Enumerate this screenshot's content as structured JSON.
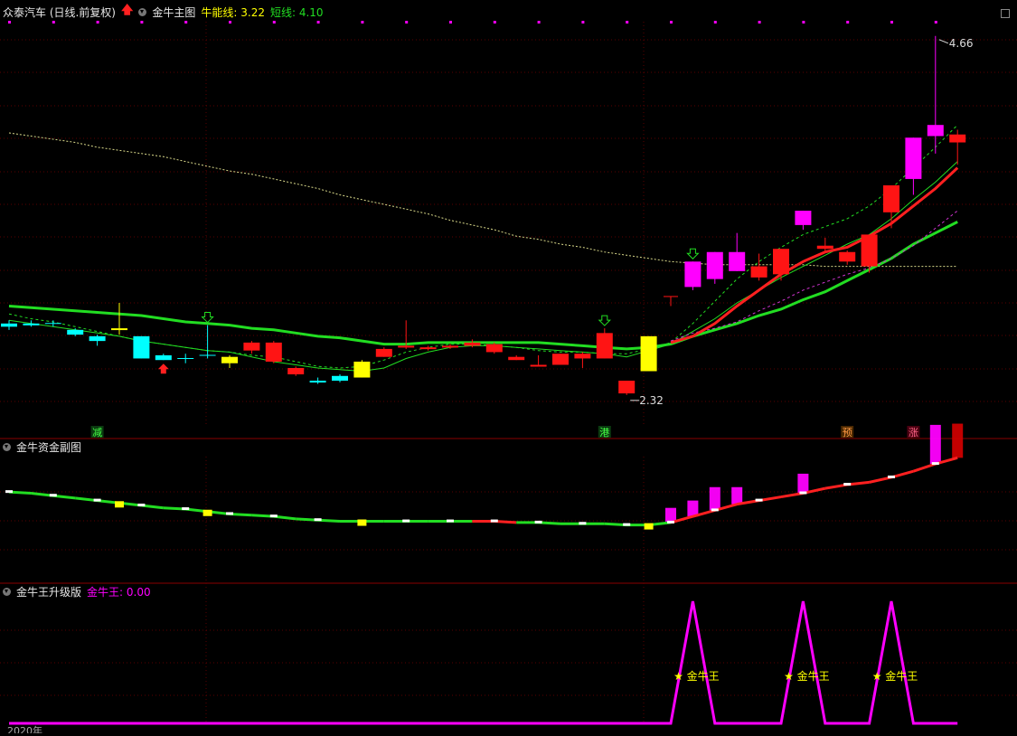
{
  "header": {
    "stock_title": "众泰汽车 (日线.前复权)",
    "main_indicator": "金牛主图",
    "bull_line_label": "牛能线: 3.22",
    "short_line_label": "短线: 4.10"
  },
  "sub_panel_1": {
    "title": "金牛资金副图"
  },
  "sub_panel_2": {
    "title": "金牛王升级版",
    "value_label": "金牛王: 0.00"
  },
  "markers": {
    "high_label": "4.66",
    "low_label": "2.32",
    "signal_jian": "减",
    "signal_gang": "港",
    "signal_yu": "预",
    "signal_zhang": "涨",
    "king_label": "★ 金牛王",
    "bottom_left_label": "2020年"
  },
  "colors": {
    "up": "#ff1414",
    "down": "#00ffff",
    "strong": "#ff00ff",
    "yellow": "#ffff00",
    "green_line": "#22dd22",
    "grid": "#5a0000",
    "panel_border": "#8a0000"
  },
  "chart_data": {
    "type": "candlestick",
    "price_range": [
      2.2,
      4.75
    ],
    "candles": [
      {
        "o": 2.85,
        "h": 2.87,
        "l": 2.81,
        "c": 2.83,
        "t": "down"
      },
      {
        "o": 2.85,
        "h": 2.87,
        "l": 2.83,
        "c": 2.84,
        "t": "down"
      },
      {
        "o": 2.85,
        "h": 2.87,
        "l": 2.83,
        "c": 2.85,
        "t": "cross"
      },
      {
        "o": 2.81,
        "h": 2.82,
        "l": 2.77,
        "c": 2.78,
        "t": "down"
      },
      {
        "o": 2.77,
        "h": 2.78,
        "l": 2.71,
        "c": 2.74,
        "t": "down"
      },
      {
        "o": 2.81,
        "h": 2.98,
        "l": 2.78,
        "c": 2.82,
        "t": "yellow"
      },
      {
        "o": 2.77,
        "h": 2.77,
        "l": 2.63,
        "c": 2.63,
        "t": "down"
      },
      {
        "o": 2.65,
        "h": 2.66,
        "l": 2.62,
        "c": 2.62,
        "t": "down"
      },
      {
        "o": 2.63,
        "h": 2.66,
        "l": 2.6,
        "c": 2.63,
        "t": "cross"
      },
      {
        "o": 2.65,
        "h": 2.84,
        "l": 2.63,
        "c": 2.65,
        "t": "cross"
      },
      {
        "o": 2.6,
        "h": 2.65,
        "l": 2.57,
        "c": 2.64,
        "t": "yellow"
      },
      {
        "o": 2.68,
        "h": 2.74,
        "l": 2.66,
        "c": 2.73,
        "t": "up"
      },
      {
        "o": 2.73,
        "h": 2.74,
        "l": 2.6,
        "c": 2.61,
        "t": "up"
      },
      {
        "o": 2.53,
        "h": 2.58,
        "l": 2.52,
        "c": 2.57,
        "t": "up"
      },
      {
        "o": 2.49,
        "h": 2.51,
        "l": 2.47,
        "c": 2.48,
        "t": "down"
      },
      {
        "o": 2.52,
        "h": 2.53,
        "l": 2.48,
        "c": 2.49,
        "t": "down"
      },
      {
        "o": 2.51,
        "h": 2.62,
        "l": 2.51,
        "c": 2.61,
        "t": "yellow"
      },
      {
        "o": 2.64,
        "h": 2.7,
        "l": 2.64,
        "c": 2.69,
        "t": "up"
      },
      {
        "o": 2.7,
        "h": 2.87,
        "l": 2.69,
        "c": 2.71,
        "t": "up"
      },
      {
        "o": 2.69,
        "h": 2.71,
        "l": 2.68,
        "c": 2.7,
        "t": "up"
      },
      {
        "o": 2.7,
        "h": 2.72,
        "l": 2.69,
        "c": 2.71,
        "t": "up"
      },
      {
        "o": 2.71,
        "h": 2.75,
        "l": 2.7,
        "c": 2.73,
        "t": "up"
      },
      {
        "o": 2.67,
        "h": 2.73,
        "l": 2.66,
        "c": 2.72,
        "t": "up"
      },
      {
        "o": 2.62,
        "h": 2.65,
        "l": 2.62,
        "c": 2.64,
        "t": "up"
      },
      {
        "o": 2.58,
        "h": 2.65,
        "l": 2.58,
        "c": 2.59,
        "t": "up"
      },
      {
        "o": 2.59,
        "h": 2.66,
        "l": 2.59,
        "c": 2.66,
        "t": "up"
      },
      {
        "o": 2.63,
        "h": 2.67,
        "l": 2.57,
        "c": 2.66,
        "t": "up"
      },
      {
        "o": 2.63,
        "h": 2.82,
        "l": 2.63,
        "c": 2.79,
        "t": "up"
      },
      {
        "o": 2.41,
        "h": 2.49,
        "l": 2.4,
        "c": 2.49,
        "t": "up"
      },
      {
        "o": 2.55,
        "h": 2.77,
        "l": 2.55,
        "c": 2.77,
        "t": "yellow"
      },
      {
        "o": 3.02,
        "h": 3.02,
        "l": 2.96,
        "c": 3.02,
        "t": "up_t"
      },
      {
        "o": 3.08,
        "h": 3.24,
        "l": 3.06,
        "c": 3.24,
        "t": "strong"
      },
      {
        "o": 3.13,
        "h": 3.3,
        "l": 3.1,
        "c": 3.3,
        "t": "strong"
      },
      {
        "o": 3.18,
        "h": 3.42,
        "l": 3.18,
        "c": 3.3,
        "t": "strong"
      },
      {
        "o": 3.21,
        "h": 3.29,
        "l": 3.12,
        "c": 3.14,
        "t": "up"
      },
      {
        "o": 3.16,
        "h": 3.32,
        "l": 3.12,
        "c": 3.32,
        "t": "up"
      },
      {
        "o": 3.47,
        "h": 3.56,
        "l": 3.44,
        "c": 3.56,
        "t": "strong"
      },
      {
        "o": 3.32,
        "h": 3.39,
        "l": 3.3,
        "c": 3.34,
        "t": "up"
      },
      {
        "o": 3.24,
        "h": 3.31,
        "l": 3.22,
        "c": 3.3,
        "t": "up"
      },
      {
        "o": 3.21,
        "h": 3.41,
        "l": 3.17,
        "c": 3.41,
        "t": "up"
      },
      {
        "o": 3.55,
        "h": 3.72,
        "l": 3.45,
        "c": 3.72,
        "t": "up"
      },
      {
        "o": 3.76,
        "h": 4.02,
        "l": 3.66,
        "c": 4.02,
        "t": "strong"
      },
      {
        "o": 4.03,
        "h": 4.66,
        "l": 3.92,
        "c": 4.1,
        "t": "strong"
      },
      {
        "o": 3.99,
        "h": 4.07,
        "l": 3.85,
        "c": 4.04,
        "t": "up"
      }
    ],
    "lines": {
      "main_green": [
        2.96,
        2.95,
        2.94,
        2.93,
        2.92,
        2.91,
        2.9,
        2.88,
        2.86,
        2.85,
        2.84,
        2.82,
        2.81,
        2.79,
        2.77,
        2.76,
        2.74,
        2.72,
        2.72,
        2.73,
        2.73,
        2.73,
        2.73,
        2.73,
        2.73,
        2.72,
        2.71,
        2.7,
        2.69,
        2.7,
        2.72,
        2.77,
        2.81,
        2.85,
        2.9,
        2.94,
        3.0,
        3.05,
        3.12,
        3.19,
        3.26,
        3.35,
        3.42,
        3.49
      ],
      "thin_green": [
        2.87,
        2.85,
        2.83,
        2.81,
        2.79,
        2.77,
        2.74,
        2.72,
        2.7,
        2.68,
        2.67,
        2.64,
        2.61,
        2.59,
        2.57,
        2.56,
        2.55,
        2.57,
        2.63,
        2.67,
        2.7,
        2.71,
        2.71,
        2.7,
        2.69,
        2.68,
        2.67,
        2.66,
        2.64,
        2.68,
        2.72,
        2.8,
        2.88,
        2.98,
        3.06,
        3.14,
        3.21,
        3.28,
        3.35,
        3.41,
        3.51,
        3.63,
        3.74,
        3.87
      ],
      "green_dashed": [
        2.91,
        2.88,
        2.86,
        2.83,
        2.8,
        2.77,
        2.74,
        2.72,
        2.7,
        2.68,
        2.67,
        2.65,
        2.64,
        2.61,
        2.58,
        2.57,
        2.58,
        2.62,
        2.67,
        2.7,
        2.72,
        2.72,
        2.71,
        2.7,
        2.68,
        2.67,
        2.67,
        2.66,
        2.66,
        2.69,
        2.73,
        2.85,
        2.99,
        3.13,
        3.24,
        3.33,
        3.41,
        3.46,
        3.51,
        3.59,
        3.7,
        3.83,
        3.96,
        4.1
      ],
      "red_line": [
        null,
        null,
        null,
        null,
        null,
        null,
        null,
        null,
        null,
        null,
        null,
        null,
        null,
        null,
        null,
        null,
        null,
        null,
        null,
        null,
        null,
        null,
        null,
        null,
        null,
        null,
        null,
        null,
        null,
        null,
        2.73,
        2.77,
        2.85,
        2.96,
        3.06,
        3.16,
        3.24,
        3.3,
        3.33,
        3.4,
        3.48,
        3.59,
        3.7,
        3.83
      ],
      "magenta_dashed": [
        null,
        null,
        null,
        null,
        null,
        null,
        null,
        null,
        null,
        null,
        null,
        null,
        null,
        null,
        null,
        null,
        null,
        null,
        null,
        null,
        null,
        null,
        null,
        null,
        null,
        null,
        null,
        null,
        null,
        null,
        2.74,
        2.79,
        2.82,
        2.86,
        2.93,
        2.99,
        3.06,
        3.11,
        3.16,
        3.2,
        3.26,
        3.34,
        3.45,
        3.56
      ],
      "long_yellow_dotted": [
        4.05,
        4.03,
        4.01,
        3.99,
        3.96,
        3.94,
        3.92,
        3.9,
        3.87,
        3.84,
        3.81,
        3.79,
        3.76,
        3.73,
        3.7,
        3.66,
        3.63,
        3.6,
        3.57,
        3.54,
        3.5,
        3.47,
        3.44,
        3.4,
        3.38,
        3.35,
        3.33,
        3.3,
        3.28,
        3.26,
        3.24,
        3.23,
        3.22,
        3.22,
        3.22,
        3.22,
        3.22,
        3.21,
        3.21,
        3.21,
        3.21,
        3.21,
        3.21,
        3.21
      ]
    },
    "signals": {
      "down_arrow_idx": [
        9,
        27,
        31
      ],
      "up_arrow_idx": [
        7
      ]
    },
    "capital_panel": {
      "range": [
        0,
        100
      ],
      "line": [
        71,
        70,
        68,
        66,
        64,
        62,
        60,
        58,
        57,
        55,
        53,
        52,
        51,
        49,
        48,
        47,
        47,
        47,
        47,
        47,
        47,
        47,
        47,
        46,
        46,
        45,
        45,
        45,
        44,
        44,
        46,
        51,
        56,
        61,
        64,
        67,
        70,
        74,
        77,
        79,
        83,
        88,
        94,
        99
      ],
      "line_color": [
        "green",
        "green",
        "green",
        "green",
        "green",
        "green",
        "green",
        "green",
        "green",
        "green",
        "green",
        "green",
        "green",
        "green",
        "green",
        "green",
        "green",
        "green",
        "green",
        "green",
        "green",
        "red",
        "red",
        "green",
        "green",
        "green",
        "green",
        "green",
        "green",
        "green",
        "red",
        "red",
        "red",
        "red",
        "red",
        "red",
        "red",
        "red",
        "red",
        "red",
        "red",
        "red",
        "red",
        "red"
      ],
      "yellow_blocks": [
        5,
        9,
        16,
        29
      ],
      "bars": [
        {
          "i": 30,
          "top": 58,
          "c": "magenta"
        },
        {
          "i": 31,
          "top": 64,
          "c": "magenta"
        },
        {
          "i": 32,
          "top": 75,
          "c": "magenta"
        },
        {
          "i": 33,
          "top": 75,
          "c": "magenta"
        },
        {
          "i": 36,
          "top": 86,
          "c": "magenta"
        },
        {
          "i": 42,
          "top": 126,
          "c": "magenta"
        },
        {
          "i": 43,
          "top": 127,
          "c": "darkred"
        }
      ]
    },
    "king_panel": {
      "range": [
        0,
        1
      ],
      "series": [
        0,
        0,
        0,
        0,
        0,
        0,
        0,
        0,
        0,
        0,
        0,
        0,
        0,
        0,
        0,
        0,
        0,
        0,
        0,
        0,
        0,
        0,
        0,
        0,
        0,
        0,
        0,
        0,
        0,
        0,
        0,
        1,
        0,
        0,
        0,
        0,
        1,
        0,
        0,
        0,
        1,
        0,
        0,
        0
      ],
      "current": 0.0
    }
  }
}
